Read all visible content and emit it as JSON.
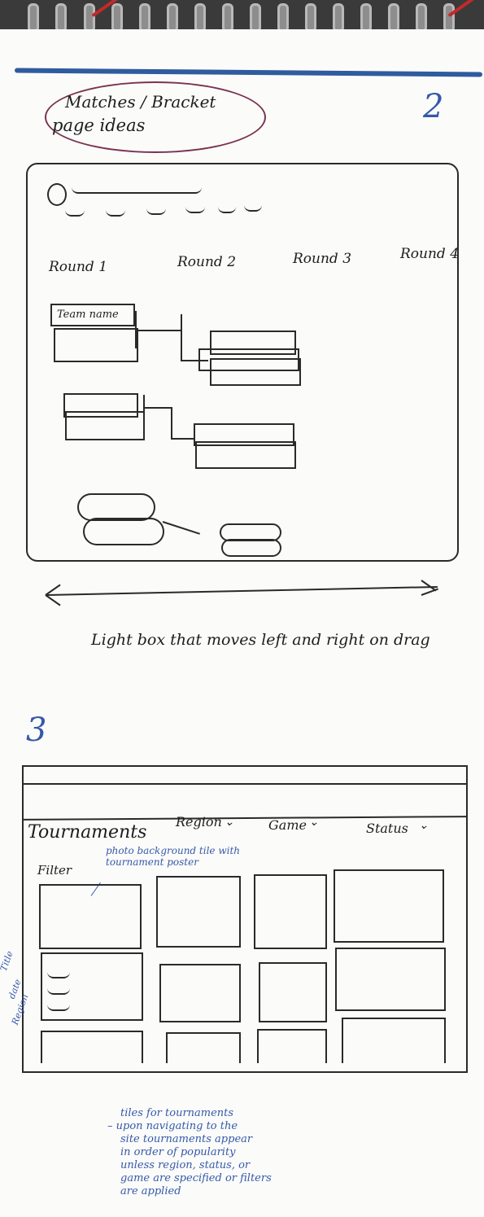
{
  "sketch1": {
    "page_number": "2",
    "heading_line1": "Matches / Bracket",
    "heading_line2": "page ideas",
    "rounds": [
      "Round 1",
      "Round 2",
      "Round 3",
      "Round 4"
    ],
    "team_name_label": "Team name",
    "caption": "Light box that moves left and right on drag"
  },
  "sketch2": {
    "page_number": "3",
    "title": "Tournaments",
    "dropdowns": [
      "Region",
      "Game",
      "Status"
    ],
    "filter_label": "Filter",
    "tile_note": "photo background tile with tournament poster",
    "side_labels": [
      "Title",
      "date",
      "Region"
    ],
    "notes": [
      "tiles for tournaments",
      "– upon navigating to the",
      "site tournaments appear",
      "in order of popularity",
      "unless region, status, or",
      "game are specified or filters",
      "are applied"
    ]
  },
  "colors": {
    "ink": "#2a2a2a",
    "blue_ink": "#3559a8",
    "accent_rule": "#2f5c9e",
    "oval": "#7a3350"
  }
}
